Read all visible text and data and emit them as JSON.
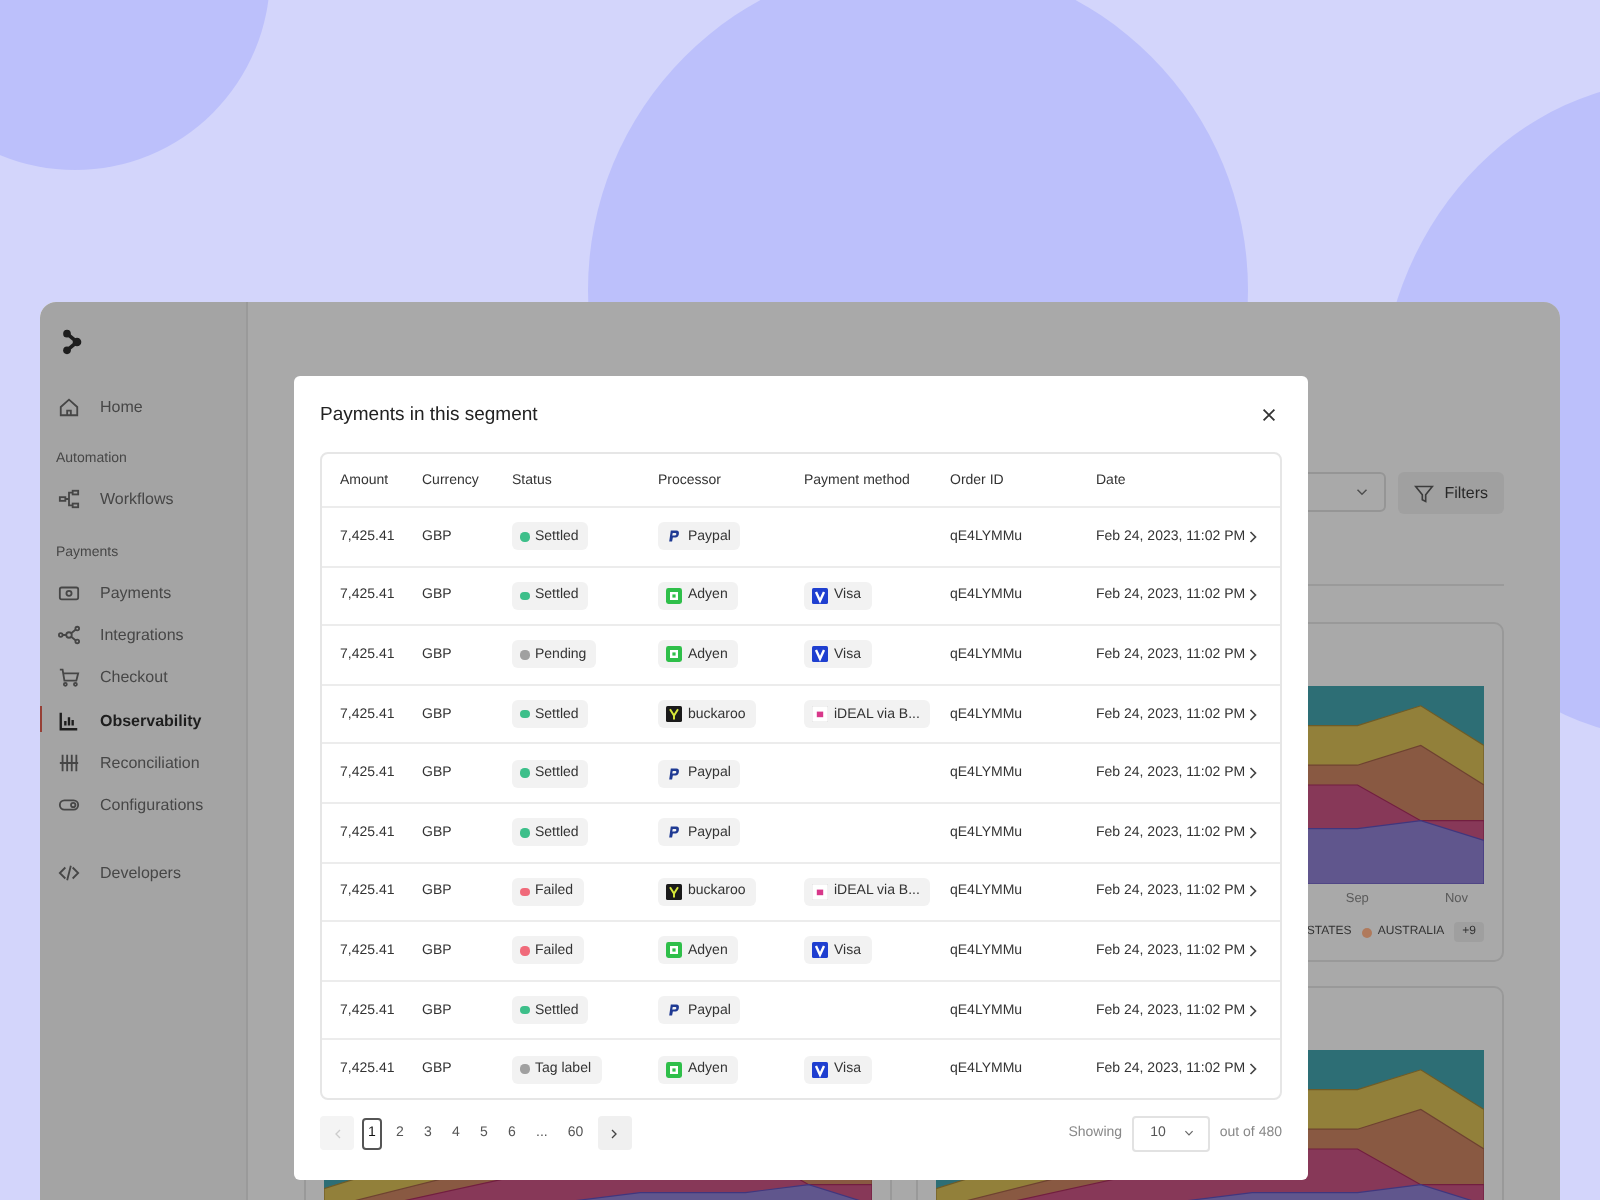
{
  "sidebar": {
    "sections": [
      {
        "items": [
          {
            "label": "Home",
            "selected": false
          }
        ]
      },
      {
        "heading": "Automation",
        "items": [
          {
            "label": "Workflows",
            "selected": false
          }
        ]
      },
      {
        "heading": "Payments",
        "items": [
          {
            "label": "Payments",
            "selected": false
          },
          {
            "label": "Integrations",
            "selected": false
          },
          {
            "label": "Checkout",
            "selected": false
          },
          {
            "label": "Observability",
            "selected": true
          },
          {
            "label": "Reconciliation",
            "selected": false
          },
          {
            "label": "Configurations",
            "selected": false
          }
        ]
      },
      {
        "items": [
          {
            "label": "Developers",
            "selected": false
          }
        ]
      }
    ]
  },
  "toolbar": {
    "filters_button": "Filters"
  },
  "chart": {
    "x_labels": [
      "Sep",
      "Nov"
    ],
    "legend": [
      {
        "label": "STATES"
      },
      {
        "label": "AUSTRALIA",
        "color": "#b07a5c"
      }
    ],
    "more_badge": "+9"
  },
  "modal": {
    "title": "Payments in this segment",
    "columns": [
      "Amount",
      "Currency",
      "Status",
      "Processor",
      "Payment method",
      "Order ID",
      "Date"
    ],
    "rows": [
      {
        "amount": "7,425.41",
        "currency": "GBP",
        "status": {
          "label": "Settled",
          "color": "#3dbf8a"
        },
        "processor": {
          "name": "Paypal",
          "kind": "paypal"
        },
        "order_id": "qE4LYMMu",
        "date": "Feb 24, 2023, 11:02 PM"
      },
      {
        "amount": "7,425.41",
        "currency": "GBP",
        "status": {
          "label": "Settled",
          "color": "#3dbf8a"
        },
        "processor": {
          "name": "Adyen",
          "kind": "adyen"
        },
        "method": {
          "name": "Visa",
          "kind": "visa"
        },
        "order_id": "qE4LYMMu",
        "date": "Feb 24, 2023, 11:02 PM"
      },
      {
        "amount": "7,425.41",
        "currency": "GBP",
        "status": {
          "label": "Pending",
          "color": "#a0a0a0"
        },
        "processor": {
          "name": "Adyen",
          "kind": "adyen"
        },
        "method": {
          "name": "Visa",
          "kind": "visa"
        },
        "order_id": "qE4LYMMu",
        "date": "Feb 24, 2023, 11:02 PM"
      },
      {
        "amount": "7,425.41",
        "currency": "GBP",
        "status": {
          "label": "Settled",
          "color": "#3dbf8a"
        },
        "processor": {
          "name": "buckaroo",
          "kind": "buckaroo"
        },
        "method": {
          "name": "iDEAL via B...",
          "kind": "ideal"
        },
        "order_id": "qE4LYMMu",
        "date": "Feb 24, 2023, 11:02 PM"
      },
      {
        "amount": "7,425.41",
        "currency": "GBP",
        "status": {
          "label": "Settled",
          "color": "#3dbf8a"
        },
        "processor": {
          "name": "Paypal",
          "kind": "paypal"
        },
        "order_id": "qE4LYMMu",
        "date": "Feb 24, 2023, 11:02 PM"
      },
      {
        "amount": "7,425.41",
        "currency": "GBP",
        "status": {
          "label": "Settled",
          "color": "#3dbf8a"
        },
        "processor": {
          "name": "Paypal",
          "kind": "paypal"
        },
        "order_id": "qE4LYMMu",
        "date": "Feb 24, 2023, 11:02 PM"
      },
      {
        "amount": "7,425.41",
        "currency": "GBP",
        "status": {
          "label": "Failed",
          "color": "#f06a7a"
        },
        "processor": {
          "name": "buckaroo",
          "kind": "buckaroo"
        },
        "method": {
          "name": "iDEAL via B...",
          "kind": "ideal"
        },
        "order_id": "qE4LYMMu",
        "date": "Feb 24, 2023, 11:02 PM"
      },
      {
        "amount": "7,425.41",
        "currency": "GBP",
        "status": {
          "label": "Failed",
          "color": "#f06a7a"
        },
        "processor": {
          "name": "Adyen",
          "kind": "adyen"
        },
        "method": {
          "name": "Visa",
          "kind": "visa"
        },
        "order_id": "qE4LYMMu",
        "date": "Feb 24, 2023, 11:02 PM"
      },
      {
        "amount": "7,425.41",
        "currency": "GBP",
        "status": {
          "label": "Settled",
          "color": "#3dbf8a"
        },
        "processor": {
          "name": "Paypal",
          "kind": "paypal"
        },
        "order_id": "qE4LYMMu",
        "date": "Feb 24, 2023, 11:02 PM"
      },
      {
        "amount": "7,425.41",
        "currency": "GBP",
        "status": {
          "label": "Tag label",
          "color": "#a0a0a0"
        },
        "processor": {
          "name": "Adyen",
          "kind": "adyen"
        },
        "method": {
          "name": "Visa",
          "kind": "visa"
        },
        "order_id": "qE4LYMMu",
        "date": "Feb 24, 2023, 11:02 PM"
      }
    ],
    "pagination": {
      "prev_disabled": true,
      "pages": [
        {
          "label": "1",
          "selected": true
        },
        {
          "label": "2",
          "selected": false
        },
        {
          "label": "3",
          "selected": false
        },
        {
          "label": "4",
          "selected": false
        },
        {
          "label": "5",
          "selected": false
        },
        {
          "label": "6",
          "selected": false
        },
        {
          "label": "...",
          "selected": false
        },
        {
          "label": "60",
          "selected": false
        }
      ],
      "showing_label": "Showing",
      "page_size": "10",
      "total": "out of 480"
    }
  }
}
